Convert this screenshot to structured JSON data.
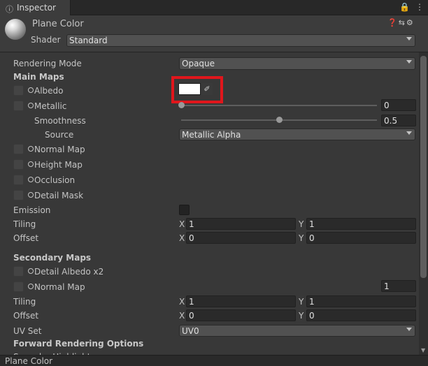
{
  "tab": {
    "title": "Inspector",
    "icon": "info-icon"
  },
  "header": {
    "material_name": "Plane Color",
    "shader_label": "Shader",
    "shader_value": "Standard"
  },
  "rendering_mode": {
    "label": "Rendering Mode",
    "value": "Opaque"
  },
  "main_maps": {
    "heading": "Main Maps",
    "albedo": {
      "label": "Albedo",
      "color": "#ffffff"
    },
    "metallic": {
      "label": "Metallic",
      "value": "0",
      "fraction": 0
    },
    "smoothness": {
      "label": "Smoothness",
      "value": "0.5",
      "fraction": 0.5
    },
    "source": {
      "label": "Source",
      "value": "Metallic Alpha"
    },
    "normal_map": {
      "label": "Normal Map"
    },
    "height_map": {
      "label": "Height Map"
    },
    "occlusion": {
      "label": "Occlusion"
    },
    "detail_mask": {
      "label": "Detail Mask"
    },
    "emission": {
      "label": "Emission",
      "checked": false
    },
    "tiling": {
      "label": "Tiling",
      "x": "1",
      "y": "1"
    },
    "offset": {
      "label": "Offset",
      "x": "0",
      "y": "0"
    }
  },
  "secondary_maps": {
    "heading": "Secondary Maps",
    "detail_albedo": {
      "label": "Detail Albedo x2"
    },
    "normal_map": {
      "label": "Normal Map",
      "value": "1"
    },
    "tiling": {
      "label": "Tiling",
      "x": "1",
      "y": "1"
    },
    "offset": {
      "label": "Offset",
      "x": "0",
      "y": "0"
    },
    "uv_set": {
      "label": "UV Set",
      "value": "UV0"
    }
  },
  "forward_rendering": {
    "heading": "Forward Rendering Options",
    "specular_label": "Specular Highlights"
  },
  "axis": {
    "x": "X",
    "y": "Y"
  },
  "footer": {
    "label": "Plane Color"
  },
  "colors": {
    "highlight": "#e0161c",
    "background": "#383838",
    "field": "#2a2a2a"
  }
}
